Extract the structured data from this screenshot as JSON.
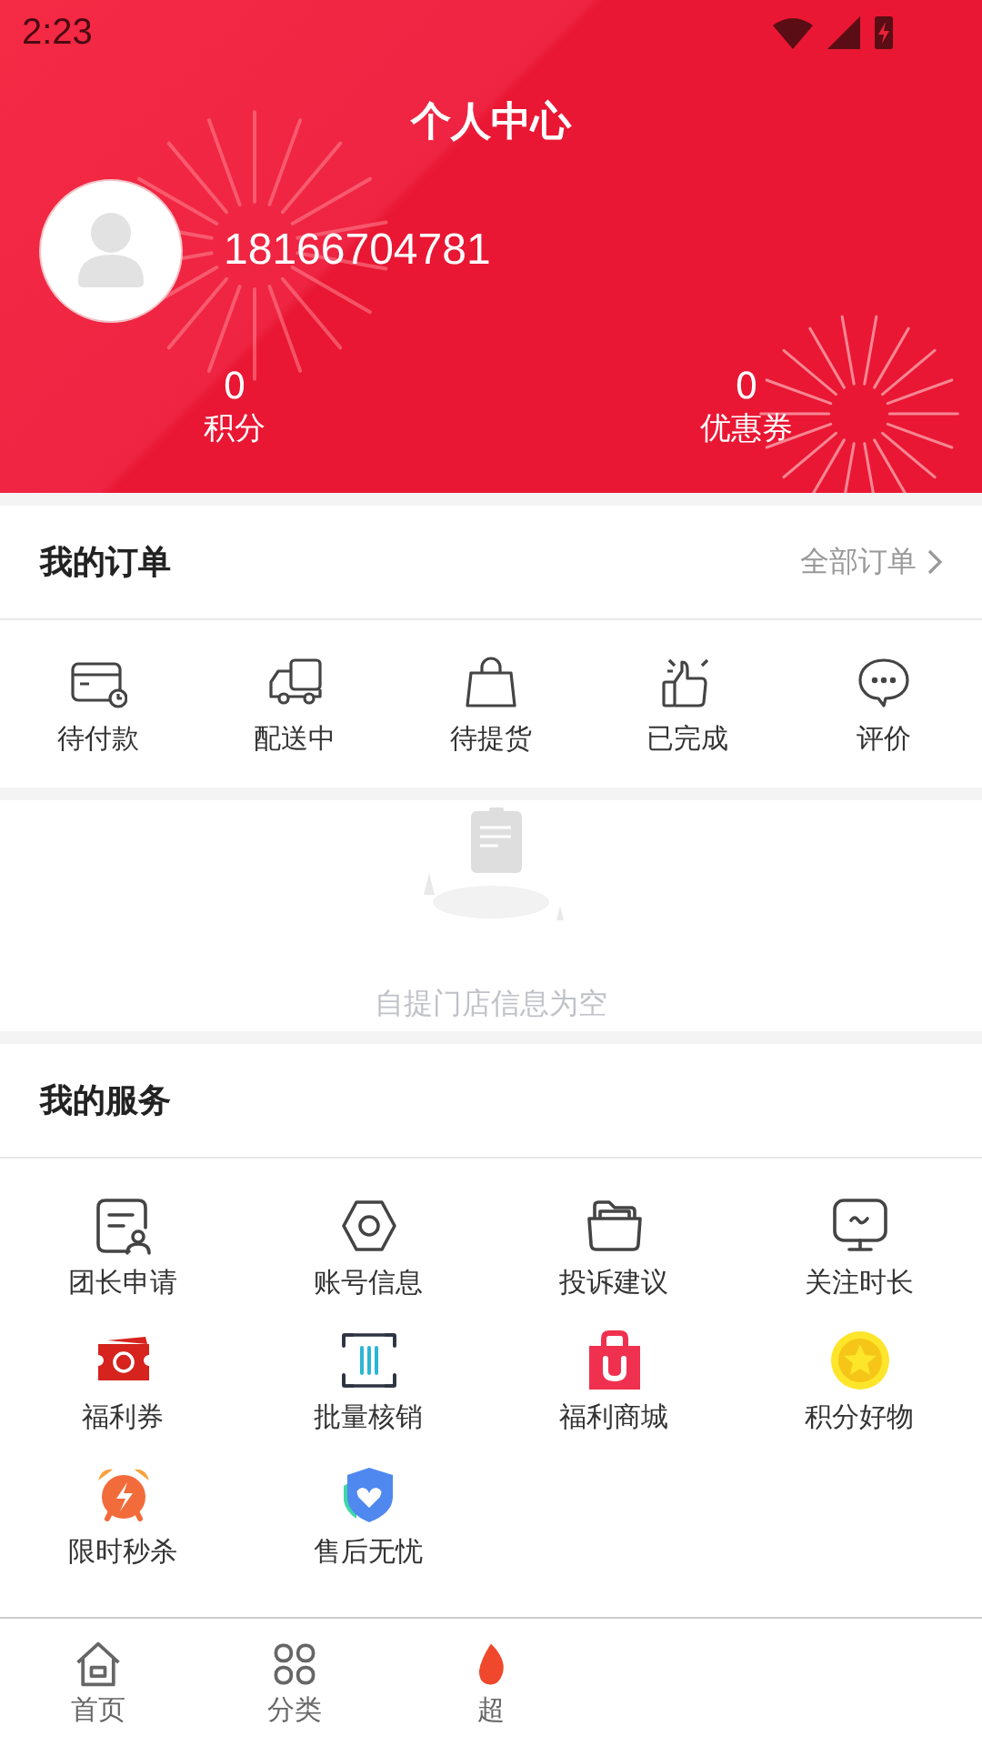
{
  "status_bar": {
    "time": "2:23"
  },
  "header": {
    "title": "个人中心",
    "phone": "18166704781",
    "stats": [
      {
        "value": "0",
        "label": "积分"
      },
      {
        "value": "0",
        "label": "优惠券"
      }
    ]
  },
  "orders": {
    "title": "我的订单",
    "link": "全部订单",
    "items": [
      {
        "kind": "card",
        "label": "待付款"
      },
      {
        "kind": "truck",
        "label": "配送中"
      },
      {
        "kind": "bag",
        "label": "待提货"
      },
      {
        "kind": "thumb",
        "label": "已完成"
      },
      {
        "kind": "chat",
        "label": "评价"
      }
    ]
  },
  "store": {
    "message": "自提门店信息为空"
  },
  "services": {
    "title": "我的服务",
    "items": [
      {
        "kind": "form",
        "label": "团长申请"
      },
      {
        "kind": "hexagon",
        "label": "账号信息"
      },
      {
        "kind": "folder",
        "label": "投诉建议"
      },
      {
        "kind": "monitor",
        "label": "关注时长"
      },
      {
        "kind": "coupon",
        "label": "福利券"
      },
      {
        "kind": "scan",
        "label": "批量核销"
      },
      {
        "kind": "shop",
        "label": "福利商城"
      },
      {
        "kind": "coin",
        "label": "积分好物"
      },
      {
        "kind": "alarm",
        "label": "限时秒杀"
      },
      {
        "kind": "shield",
        "label": "售后无忧"
      }
    ]
  },
  "nav": {
    "items": [
      {
        "kind": "home",
        "label": "首页"
      },
      {
        "kind": "grid",
        "label": "分类"
      },
      {
        "kind": "flame",
        "label": "超"
      }
    ]
  }
}
